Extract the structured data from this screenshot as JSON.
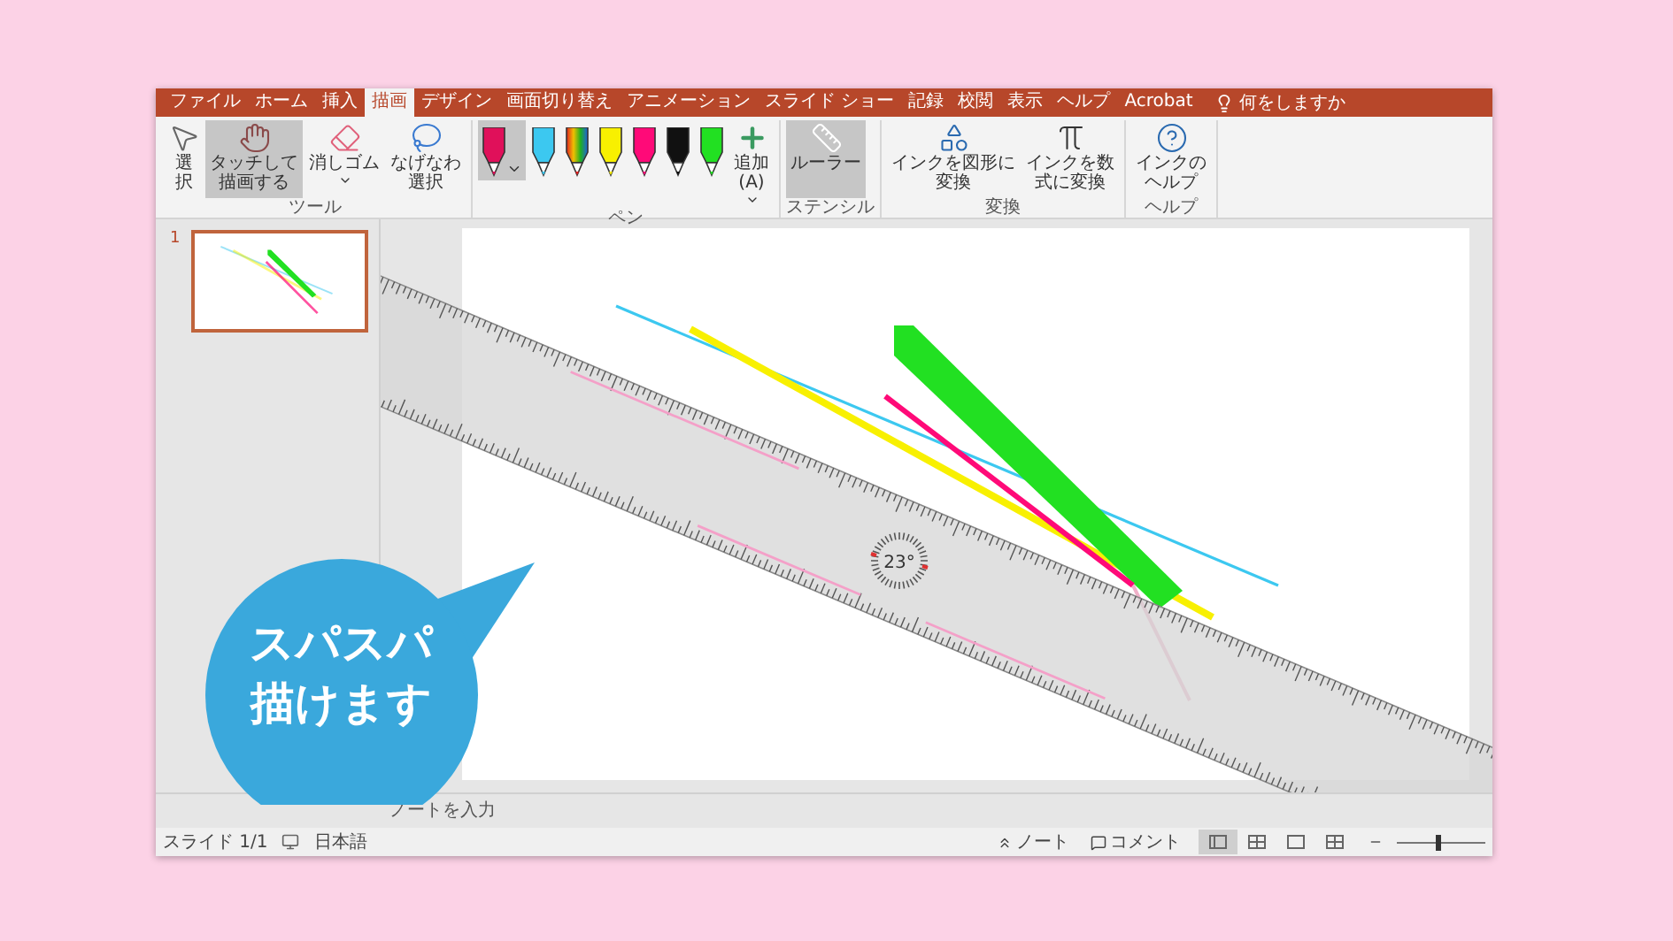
{
  "tabs": [
    {
      "label": "ファイル",
      "selected": false
    },
    {
      "label": "ホーム",
      "selected": false
    },
    {
      "label": "挿入",
      "selected": false
    },
    {
      "label": "描画",
      "selected": true
    },
    {
      "label": "デザイン",
      "selected": false
    },
    {
      "label": "画面切り替え",
      "selected": false
    },
    {
      "label": "アニメーション",
      "selected": false
    },
    {
      "label": "スライド ショー",
      "selected": false
    },
    {
      "label": "記録",
      "selected": false
    },
    {
      "label": "校閲",
      "selected": false
    },
    {
      "label": "表示",
      "selected": false
    },
    {
      "label": "ヘルプ",
      "selected": false
    },
    {
      "label": "Acrobat",
      "selected": false
    }
  ],
  "tell_me": "何をしますか",
  "ribbon": [
    {
      "label": "ツール",
      "items": [
        {
          "kind": "select",
          "label": "選択",
          "selected": false
        },
        {
          "kind": "touch",
          "label": "タッチして描画する",
          "selected": true
        },
        {
          "kind": "eraser",
          "label": "消しゴム",
          "selected": false
        },
        {
          "kind": "lasso",
          "label": "なげなわ選択",
          "selected": false
        }
      ]
    },
    {
      "label": "ペン",
      "items": [
        {
          "kind": "pen",
          "color": "#e0105a",
          "selected": true
        },
        {
          "kind": "pen",
          "color": "#3cc8f0",
          "selected": false
        },
        {
          "kind": "rainbow_pen",
          "selected": false
        },
        {
          "kind": "pen",
          "color": "#f8f000",
          "selected": false
        },
        {
          "kind": "pen",
          "color": "#ff0a78",
          "selected": false
        },
        {
          "kind": "pen",
          "color": "#111111",
          "selected": false
        },
        {
          "kind": "pen",
          "color": "#22e022",
          "selected": false
        },
        {
          "kind": "add",
          "label": "追加(A)"
        }
      ]
    },
    {
      "label": "ステンシル",
      "items": [
        {
          "kind": "ruler",
          "label": "ルーラー",
          "selected": true
        }
      ]
    },
    {
      "label": "変換",
      "items": [
        {
          "kind": "shape",
          "label": "インクを図形に変換"
        },
        {
          "kind": "math",
          "label": "インクを数式に変換"
        }
      ]
    },
    {
      "label": "ヘルプ",
      "items": [
        {
          "kind": "help",
          "label": "インクのヘルプ"
        }
      ]
    }
  ],
  "slides": [
    {
      "number": "1",
      "selected": true
    }
  ],
  "ruler": {
    "angle": "23°"
  },
  "notes": {
    "placeholder": "ノートを入力"
  },
  "status_bar": {
    "slide": "スライド 1/1",
    "language": "日本語",
    "notes": "ノート",
    "comments": "コメント",
    "views": [
      {
        "selected": true
      },
      {
        "selected": false
      },
      {
        "selected": false
      },
      {
        "selected": false
      }
    ],
    "zoom": {
      "level": 0.45
    }
  },
  "callout": {
    "text": "スパスパ描けます"
  }
}
